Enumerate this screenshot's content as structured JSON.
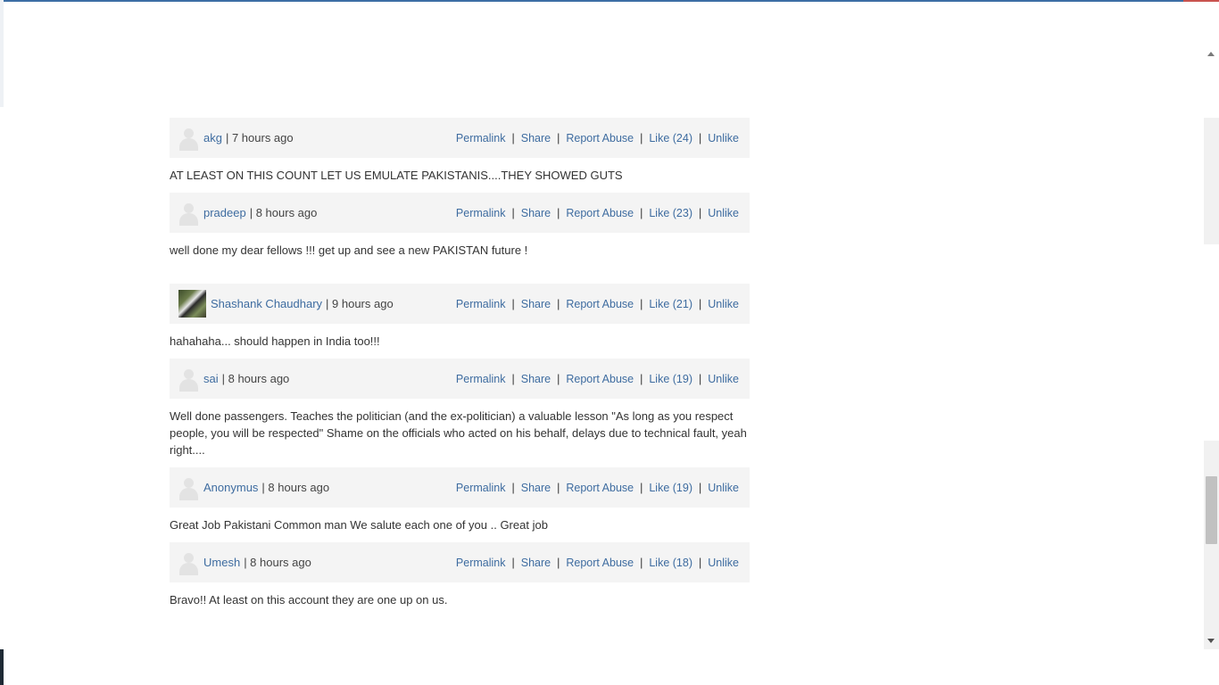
{
  "comments": [
    {
      "author": "akg",
      "time": "| 7 hours ago",
      "text": "AT LEAST ON THIS COUNT LET US EMULATE PAKISTANIS....THEY SHOWED GUTS",
      "permalink": "Permalink",
      "share": "Share",
      "report": "Report Abuse",
      "like": "Like (24)",
      "like_count": 24,
      "unlike": "Unlike",
      "avatar": "default-avatar-icon"
    },
    {
      "author": "pradeep",
      "time": "| 8 hours ago",
      "text": "well done my dear fellows !!! get up and see a new PAKISTAN future !",
      "permalink": "Permalink",
      "share": "Share",
      "report": "Report Abuse",
      "like": "Like (23)",
      "like_count": 23,
      "unlike": "Unlike",
      "avatar": "default-avatar-icon"
    },
    {
      "author": "Shashank Chaudhary",
      "time": "| 9 hours ago",
      "text": "hahahaha... should happen in India too!!!",
      "permalink": "Permalink",
      "share": "Share",
      "report": "Report Abuse",
      "like": "Like (21)",
      "like_count": 21,
      "unlike": "Unlike",
      "avatar": "user-photo"
    },
    {
      "author": "sai",
      "time": "| 8 hours ago",
      "text": "Well done passengers. Teaches the politician (and the ex-politician) a valuable lesson \"As long as you respect people, you will be respected\" Shame on the officials who acted on his behalf, delays due to technical fault, yeah right....",
      "permalink": "Permalink",
      "share": "Share",
      "report": "Report Abuse",
      "like": "Like (19)",
      "like_count": 19,
      "unlike": "Unlike",
      "avatar": "default-avatar-icon"
    },
    {
      "author": "Anonymus",
      "time": "| 8 hours ago",
      "text": "Great Job Pakistani Common man We salute each one of you .. Great job",
      "permalink": "Permalink",
      "share": "Share",
      "report": "Report Abuse",
      "like": "Like (19)",
      "like_count": 19,
      "unlike": "Unlike",
      "avatar": "default-avatar-icon"
    },
    {
      "author": "Umesh",
      "time": "| 8 hours ago",
      "text": "Bravo!! At least on this account they are one up on us.",
      "permalink": "Permalink",
      "share": "Share",
      "report": "Report Abuse",
      "like": "Like (18)",
      "like_count": 18,
      "unlike": "Unlike",
      "avatar": "default-avatar-icon"
    }
  ],
  "separator": "|"
}
